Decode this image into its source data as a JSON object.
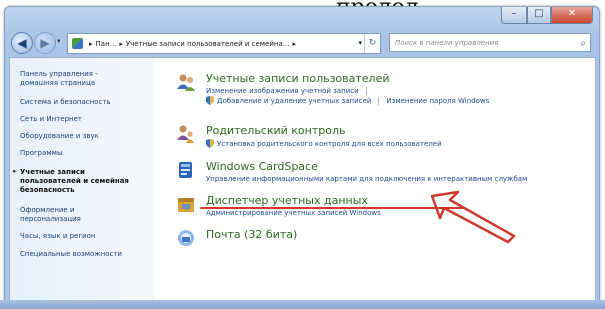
{
  "document_text": "продол",
  "window": {
    "minimize_label": "–",
    "maximize_label": "□",
    "close_label": "✕"
  },
  "toolbar": {
    "back_icon": "arrow-left-icon",
    "forward_icon": "arrow-right-icon",
    "address": {
      "crumbs": [
        "Пан...",
        "Учетные записи пользователей и семейна..."
      ],
      "separator": "▸"
    },
    "search_placeholder": "Поиск в панели управления"
  },
  "sidebar": {
    "items": [
      {
        "label": "Панель управления -",
        "label2": "домашняя страница",
        "active": false
      },
      {
        "label": "Система и безопасность",
        "active": false
      },
      {
        "label": "Сеть и Интернет",
        "active": false
      },
      {
        "label": "Оборудование и звук",
        "active": false
      },
      {
        "label": "Программы",
        "active": false
      },
      {
        "label": "Учетные записи",
        "label2": "пользователей и семейная",
        "label3": "безопасность",
        "active": true
      },
      {
        "label": "Оформление и",
        "label2": "персонализация",
        "active": false
      },
      {
        "label": "Часы, язык и регион",
        "active": false
      },
      {
        "label": "Специальные возможности",
        "active": false
      }
    ]
  },
  "sections": [
    {
      "title": "Учетные записи пользователей",
      "icon": "users-icon",
      "links": [
        "Изменение изображения учетной записи"
      ],
      "links2": [
        "Добавление и удаление учетных записей",
        "Изменение пароля Windows"
      ]
    },
    {
      "title": "Родительский контроль",
      "icon": "parental-control-icon",
      "links": [
        "Установка родительского контроля для всех пользователей"
      ]
    },
    {
      "title": "Windows CardSpace",
      "icon": "cardspace-icon",
      "links": [
        "Управление информационными картами для подключения к интерактивным службам"
      ]
    },
    {
      "title": "Диспетчер учетных данных",
      "icon": "credential-manager-icon",
      "links": [
        "Администрирование учетных записей Windows"
      ]
    },
    {
      "title": "Почта (32 бита)",
      "icon": "mail-icon",
      "links": []
    }
  ],
  "colors": {
    "title_green": "#2a6b1e",
    "link_blue": "#1e4b94",
    "annotation_red": "#d03a2e"
  }
}
